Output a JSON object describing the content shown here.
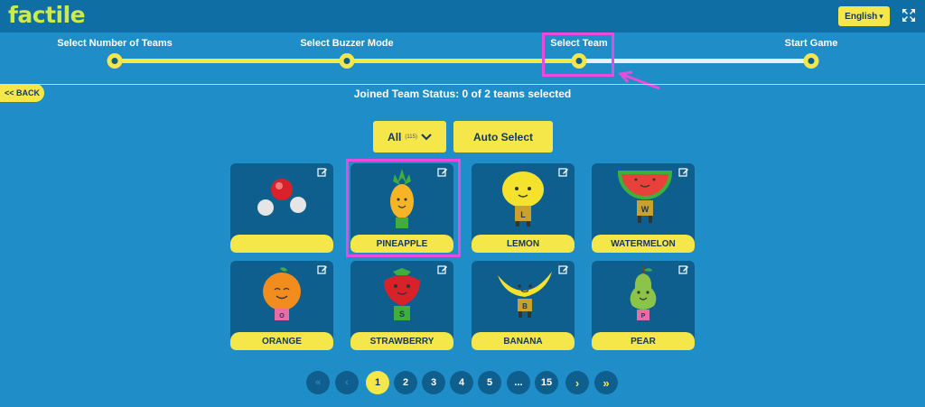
{
  "app": {
    "logo": "factile"
  },
  "header": {
    "language": "English",
    "language_caret": "⌄"
  },
  "steps": [
    {
      "label": "Select Number of Teams"
    },
    {
      "label": "Select Buzzer Mode"
    },
    {
      "label": "Select Team"
    },
    {
      "label": "Start Game"
    }
  ],
  "nav": {
    "back_label": "<< BACK"
  },
  "status": {
    "text": "Joined Team Status: 0 of 2 teams selected"
  },
  "filter": {
    "label": "All",
    "count": "(115)",
    "caret": "⌄"
  },
  "auto_select": {
    "label": "Auto Select"
  },
  "teams": [
    {
      "name": "",
      "icon": "molecule-icon"
    },
    {
      "name": "PINEAPPLE",
      "icon": "pineapple-icon"
    },
    {
      "name": "LEMON",
      "icon": "lemon-icon"
    },
    {
      "name": "WATERMELON",
      "icon": "watermelon-icon"
    },
    {
      "name": "ORANGE",
      "icon": "orange-icon"
    },
    {
      "name": "STRAWBERRY",
      "icon": "strawberry-icon"
    },
    {
      "name": "BANANA",
      "icon": "banana-icon"
    },
    {
      "name": "PEAR",
      "icon": "pear-icon"
    }
  ],
  "character_letters": {
    "lemon": "L",
    "watermelon": "W",
    "orange": "O",
    "strawberry": "S",
    "banana": "B",
    "pear": "P"
  },
  "pagination": {
    "first": "«",
    "prev": "‹",
    "pages": [
      "1",
      "2",
      "3",
      "4",
      "5",
      "...",
      "15"
    ],
    "current": "1",
    "next": "›",
    "last": "»"
  },
  "colors": {
    "accent": "#f5e64a",
    "background": "#1f8ec8",
    "highlight": "#e64ddc"
  }
}
